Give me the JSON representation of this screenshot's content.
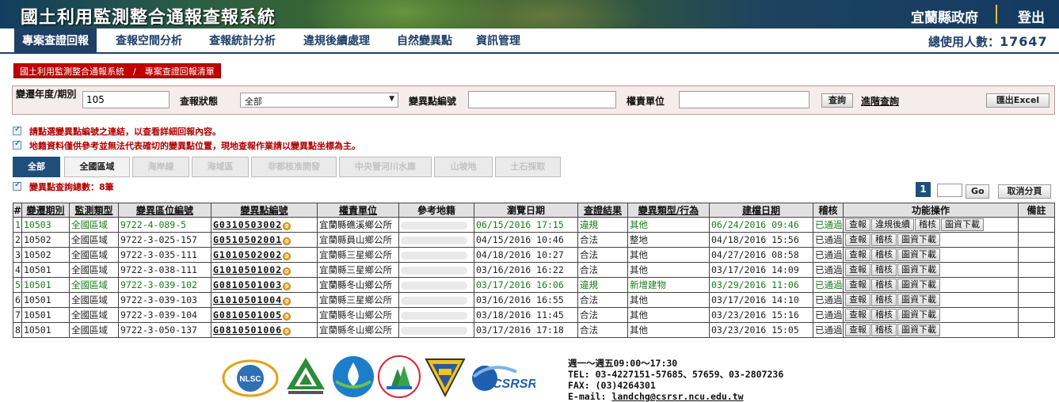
{
  "header": {
    "system_title": "國土利用監測整合通報查報系統",
    "county": "宜蘭縣政府",
    "logout": "登出"
  },
  "nav": {
    "items": [
      "專案查證回報",
      "查報空間分析",
      "查報統計分析",
      "違規後續處理",
      "自然變異點",
      "資訊管理"
    ],
    "active_index": 0,
    "total_users_label": "總使用人數：",
    "total_users": "17647"
  },
  "breadcrumb": "國土利用監測整合通報系統　/　專案查證回報清單",
  "search": {
    "period_label": "變遷年度/期別",
    "period_value": "105",
    "status_label": "查報狀態",
    "status_value": "全部",
    "point_label": "變異點編號",
    "point_value": "",
    "unit_label": "權責單位",
    "unit_value": "",
    "query_btn": "查詢",
    "advanced_link": "進階查詢",
    "export_btn": "匯出Excel"
  },
  "notes": [
    "請點選變異點編號之連結，以查看詳細回報內容。",
    "地籍資料僅供參考並無法代表確切的變異點位置，現地查報作業請以變異點坐標為主。",
    "變異點查詢總數：8筆"
  ],
  "tabs": [
    "全部",
    "全國區域",
    "海岸線",
    "海域區",
    "非都核准開發",
    "中央管河川水庫",
    "山坡地",
    "土石採取"
  ],
  "pager": {
    "current_page": "1",
    "go": "Go",
    "cancel_paging": "取消分頁"
  },
  "table": {
    "headers": [
      "#",
      "變遷期別",
      "監測類型",
      "變異區位編號",
      "變異點編號",
      "權責單位",
      "參考地籍",
      "瀏覽日期",
      "查證結果",
      "變異類型/行為",
      "建檔日期",
      "稽核",
      "功能操作",
      "備註"
    ],
    "rows": [
      {
        "no": "1",
        "period": "10503",
        "type": "全國區域",
        "loc": "9722-4-089-5",
        "id": "G0310503002",
        "unit": "宜蘭縣礁溪鄉公所",
        "date": "06/15/2016 17:15",
        "result": "違規",
        "kind": "其他",
        "created": "06/24/2016 09:46",
        "audit": "已通過",
        "actions": [
          "查報",
          "違規後續",
          "稽核",
          "圖資下載"
        ],
        "green": true
      },
      {
        "no": "2",
        "period": "10502",
        "type": "全國區域",
        "loc": "9722-3-025-157",
        "id": "G0510502001",
        "unit": "宜蘭縣員山鄉公所",
        "date": "04/15/2016 10:46",
        "result": "合法",
        "kind": "整地",
        "created": "04/18/2016 15:56",
        "audit": "已通過",
        "actions": [
          "查報",
          "稽核",
          "圖資下載"
        ],
        "green": false
      },
      {
        "no": "3",
        "period": "10502",
        "type": "全國區域",
        "loc": "9722-3-035-111",
        "id": "G1010502002",
        "unit": "宜蘭縣三星鄉公所",
        "date": "04/18/2016 10:27",
        "result": "合法",
        "kind": "其他",
        "created": "04/27/2016 08:58",
        "audit": "已通過",
        "actions": [
          "查報",
          "稽核",
          "圖資下載"
        ],
        "green": false
      },
      {
        "no": "4",
        "period": "10501",
        "type": "全國區域",
        "loc": "9722-3-038-111",
        "id": "G1010501002",
        "unit": "宜蘭縣三星鄉公所",
        "date": "03/16/2016 16:22",
        "result": "合法",
        "kind": "其他",
        "created": "03/17/2016 14:09",
        "audit": "已通過",
        "actions": [
          "查報",
          "稽核",
          "圖資下載"
        ],
        "green": false
      },
      {
        "no": "5",
        "period": "10501",
        "type": "全國區域",
        "loc": "9722-3-039-102",
        "id": "G0810501003",
        "unit": "宜蘭縣冬山鄉公所",
        "date": "03/17/2016 16:06",
        "result": "違規",
        "kind": "新增建物",
        "created": "03/29/2016 11:06",
        "audit": "已通過",
        "actions": [
          "查報",
          "稽核",
          "圖資下載"
        ],
        "green": true
      },
      {
        "no": "6",
        "period": "10501",
        "type": "全國區域",
        "loc": "9722-3-039-103",
        "id": "G1010501004",
        "unit": "宜蘭縣三星鄉公所",
        "date": "03/16/2016 16:55",
        "result": "合法",
        "kind": "其他",
        "created": "03/17/2016 14:10",
        "audit": "已通過",
        "actions": [
          "查報",
          "稽核",
          "圖資下載"
        ],
        "green": false
      },
      {
        "no": "7",
        "period": "10501",
        "type": "全國區域",
        "loc": "9722-3-039-104",
        "id": "G0810501005",
        "unit": "宜蘭縣冬山鄉公所",
        "date": "03/18/2016 11:45",
        "result": "合法",
        "kind": "其他",
        "created": "03/23/2016 15:16",
        "audit": "已通過",
        "actions": [
          "查報",
          "稽核",
          "圖資下載"
        ],
        "green": false
      },
      {
        "no": "8",
        "period": "10501",
        "type": "全國區域",
        "loc": "9722-3-050-137",
        "id": "G0810501006",
        "unit": "宜蘭縣冬山鄉公所",
        "date": "03/17/2016 17:18",
        "result": "合法",
        "kind": "其他",
        "created": "03/23/2016 15:05",
        "audit": "已通過",
        "actions": [
          "查報",
          "稽核",
          "圖資下載"
        ],
        "green": false
      }
    ]
  },
  "footer": {
    "logos": [
      "NLSC",
      "內政部營建署",
      "water-logo",
      "forest-logo",
      "soil-logo",
      "CSRSR"
    ],
    "hours": "週一～週五09:00～17:30",
    "tel": "TEL: 03-4227151-57685、57659、03-2807236",
    "fax": "FAX: (03)4264301",
    "email_label": "E-mail: ",
    "email": "landchg@csrsr.ncu.edu.tw"
  },
  "colors": {
    "nav_active": "#1e3f66",
    "violation_row": "#1a7a1a",
    "breadcrumb_bg": "#c00000",
    "notes": "#b00000"
  }
}
